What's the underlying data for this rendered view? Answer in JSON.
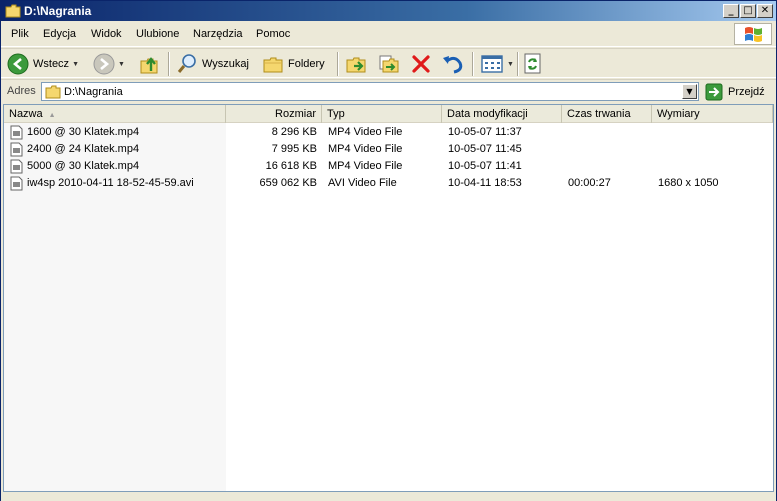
{
  "window": {
    "title": "D:\\Nagrania"
  },
  "titlebar_buttons": {
    "minimize": "_",
    "maximize": "□",
    "close": "✕"
  },
  "menu": [
    "Plik",
    "Edycja",
    "Widok",
    "Ulubione",
    "Narzędzia",
    "Pomoc"
  ],
  "toolbar": {
    "back_label": "Wstecz",
    "search_label": "Wyszukaj",
    "folders_label": "Foldery"
  },
  "address": {
    "label": "Adres",
    "path": "D:\\Nagrania",
    "go_label": "Przejdź"
  },
  "columns": {
    "name": "Nazwa",
    "size": "Rozmiar",
    "type": "Typ",
    "modified": "Data modyfikacji",
    "duration": "Czas trwania",
    "dimensions": "Wymiary"
  },
  "files": [
    {
      "name": "1600 @ 30 Klatek.mp4",
      "size": "8 296 KB",
      "type": "MP4 Video File",
      "modified": "10-05-07 11:37",
      "duration": "",
      "dimensions": ""
    },
    {
      "name": "2400 @ 24 Klatek.mp4",
      "size": "7 995 KB",
      "type": "MP4 Video File",
      "modified": "10-05-07 11:45",
      "duration": "",
      "dimensions": ""
    },
    {
      "name": "5000 @ 30 Klatek.mp4",
      "size": "16 618 KB",
      "type": "MP4 Video File",
      "modified": "10-05-07 11:41",
      "duration": "",
      "dimensions": ""
    },
    {
      "name": "iw4sp 2010-04-11 18-52-45-59.avi",
      "size": "659 062 KB",
      "type": "AVI Video File",
      "modified": "10-04-11 18:53",
      "duration": "00:00:27",
      "dimensions": "1680 x 1050"
    }
  ],
  "icons": {
    "app": "folder-icon",
    "back": "back-arrow-icon",
    "forward": "forward-arrow-icon",
    "up": "folder-up-icon",
    "search": "search-icon",
    "folders": "folders-icon",
    "move_to": "move-to-icon",
    "copy_to": "copy-to-icon",
    "delete": "delete-icon",
    "undo": "undo-icon",
    "views": "views-icon",
    "sync": "sync-icon",
    "go": "go-arrow-icon",
    "file": "file-icon"
  },
  "colors": {
    "titlebar": "#0a246a",
    "window_bg": "#ece9d8",
    "accent_green": "#3c9a3c",
    "delete_red": "#e01a1a"
  }
}
